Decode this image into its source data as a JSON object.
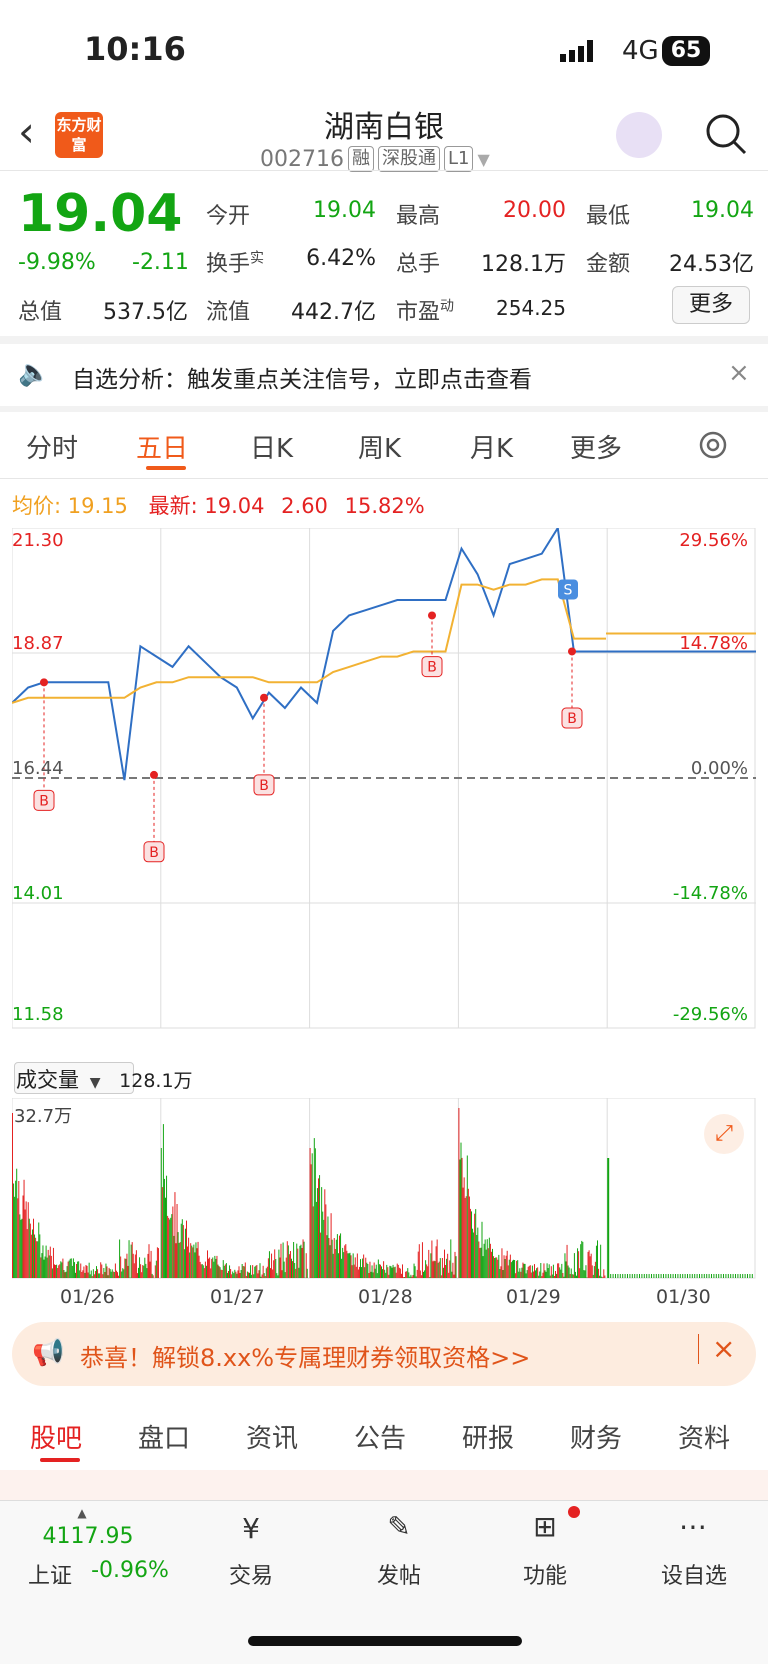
{
  "status": {
    "time": "10:16",
    "network": "4G",
    "battery": "65"
  },
  "header": {
    "title": "湖南白银",
    "code": "002716",
    "tags": [
      "融",
      "深股通",
      "L1"
    ],
    "logo": "东方财富"
  },
  "quote": {
    "price": "19.04",
    "change_pct": "-9.98%",
    "change": "-2.11",
    "open_label": "今开",
    "open": "19.04",
    "high_label": "最高",
    "high": "20.00",
    "low_label": "最低",
    "low": "19.04",
    "turnover_label": "换手",
    "turnover_sup": "实",
    "turnover": "6.42%",
    "volume_label": "总手",
    "volume": "128.1万",
    "amount_label": "金额",
    "amount": "24.53亿",
    "mktcap_label": "总值",
    "mktcap": "537.5亿",
    "float_label": "流值",
    "float": "442.7亿",
    "pe_label": "市盈",
    "pe_sup": "动",
    "pe": "254.25",
    "more": "更多"
  },
  "notice": {
    "text": "自选分析：触发重点关注信号，立即点击查看"
  },
  "tabs": [
    "分时",
    "五日",
    "日K",
    "周K",
    "月K",
    "更多"
  ],
  "legend": {
    "avg_label": "均价:",
    "avg": "19.15",
    "latest_label": "最新:",
    "latest": "19.04",
    "change": "2.60",
    "pct": "15.82%"
  },
  "chart_data": {
    "type": "line",
    "y_ticks_left": [
      "21.30",
      "18.87",
      "16.44",
      "14.01",
      "11.58"
    ],
    "y_ticks_right": [
      "29.56%",
      "14.78%",
      "0.00%",
      "-14.78%",
      "-29.56%"
    ],
    "x_labels": [
      "01/26",
      "01/27",
      "01/28",
      "01/29",
      "01/30"
    ],
    "ylim": [
      11.58,
      21.3
    ],
    "prev_close": 16.44,
    "series": [
      {
        "name": "价格",
        "values": [
          17.9,
          18.2,
          18.3,
          18.3,
          18.3,
          18.3,
          18.3,
          16.4,
          19.0,
          18.8,
          18.6,
          19.0,
          18.7,
          18.4,
          18.2,
          17.6,
          18.1,
          17.8,
          18.2,
          17.9,
          19.3,
          19.6,
          19.7,
          19.8,
          19.9,
          19.9,
          19.9,
          19.9,
          20.9,
          20.4,
          19.6,
          20.6,
          20.7,
          20.8,
          21.3,
          18.9,
          18.9,
          18.9
        ]
      },
      {
        "name": "均价",
        "values": [
          17.9,
          18.0,
          18.0,
          18.0,
          18.0,
          18.0,
          18.0,
          18.0,
          18.2,
          18.3,
          18.3,
          18.4,
          18.4,
          18.4,
          18.4,
          18.4,
          18.3,
          18.3,
          18.3,
          18.3,
          18.5,
          18.6,
          18.7,
          18.8,
          18.8,
          18.9,
          18.9,
          18.9,
          20.2,
          20.2,
          20.1,
          20.2,
          20.2,
          20.3,
          20.3,
          19.15,
          19.15,
          19.15
        ]
      }
    ],
    "markers": [
      "B",
      "B",
      "B",
      "B",
      "B",
      "S",
      "B"
    ]
  },
  "volume": {
    "label": "成交量",
    "total": "128.1万",
    "max": "32.7万"
  },
  "promo": {
    "text": "恭喜！解锁8.xx%专属理财券领取资格>>"
  },
  "bottom_tabs": [
    "股吧",
    "盘口",
    "资讯",
    "公告",
    "研报",
    "财务",
    "资料"
  ],
  "bottom_bar": {
    "index_value": "4117.95",
    "index_name": "上证",
    "index_pct": "-0.96%",
    "items": [
      "交易",
      "发帖",
      "功能",
      "设自选"
    ]
  }
}
